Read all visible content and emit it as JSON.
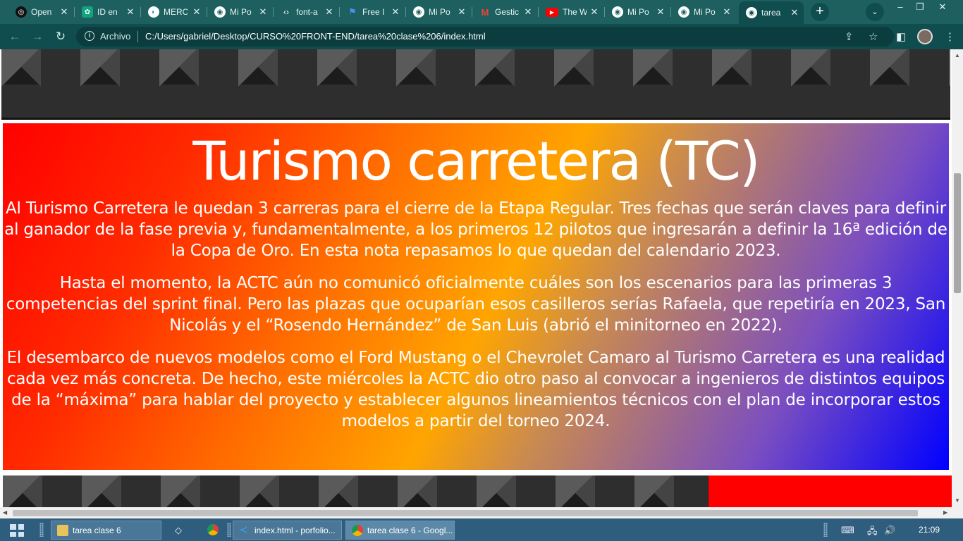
{
  "browser": {
    "tabs": [
      {
        "label": "Open",
        "icon": "openai-icon",
        "color": "#111111"
      },
      {
        "label": "ID en",
        "icon": "chatgpt-icon",
        "color": "#10a37f"
      },
      {
        "label": "MERC",
        "icon": "mercadolibre-icon",
        "color": "#2d8cf0"
      },
      {
        "label": "Mi Po",
        "icon": "globe-icon",
        "color": "#ffffff"
      },
      {
        "label": "font-a",
        "icon": "code-icon",
        "color": "#ffffff"
      },
      {
        "label": "Free I",
        "icon": "flag-icon",
        "color": "#4a8df8"
      },
      {
        "label": "Mi Po",
        "icon": "globe-icon",
        "color": "#ffffff"
      },
      {
        "label": "Gestic",
        "icon": "gmail-icon",
        "color": "#ea4335"
      },
      {
        "label": "The W",
        "icon": "youtube-icon",
        "color": "#ff0000"
      },
      {
        "label": "Mi Po",
        "icon": "globe-icon",
        "color": "#ffffff"
      },
      {
        "label": "Mi Po",
        "icon": "globe-icon",
        "color": "#ffffff"
      },
      {
        "label": "tarea",
        "icon": "globe-icon",
        "color": "#ffffff",
        "active": true
      }
    ],
    "address": {
      "scheme_label": "Archivo",
      "url": "C:/Users/gabriel/Desktop/CURSO%20FRONT-END/tarea%20clase%206/index.html"
    }
  },
  "page": {
    "title": "Turismo carretera (TC)",
    "paragraphs": [
      "Al Turismo Carretera le quedan 3 carreras para el cierre de la Etapa Regular. Tres fechas que serán claves para definir al ganador de la fase previa y, fundamentalmente, a los primeros 12 pilotos que ingresarán a definir la 16ª edición de la Copa de Oro. En esta nota repasamos lo que quedan del calendario 2023.",
      "Hasta el momento, la ACTC aún no comunicó oficialmente cuáles son los escenarios para las primeras 3 competencias del sprint final. Pero las plazas que ocuparían esos casilleros serías Rafaela, que repetiría en 2023, San Nicolás y el “Rosendo Hernández” de San Luis (abrió el minitorneo en 2022).",
      "El desembarco de nuevos modelos como el Ford Mustang o el Chevrolet Camaro al Turismo Carretera es una realidad cada vez más concreta. De hecho, este miércoles la ACTC dio otro paso al convocar a ingenieros de distintos equipos de la “máxima” para hablar del proyecto y establecer algunos lineamientos técnicos con el plan de incorporar estos modelos a partir del torneo 2024."
    ],
    "gradient_colors": [
      "#ff0000",
      "#ffa500",
      "#0000ff"
    ]
  },
  "taskbar": {
    "buttons": [
      {
        "label": "tarea clase 6",
        "icon": "folder-icon"
      },
      {
        "label": "index.html - porfolio...",
        "icon": "vscode-icon"
      },
      {
        "label": "tarea clase 6 - Googl...",
        "icon": "chrome-icon"
      }
    ],
    "clock": "21:09"
  }
}
